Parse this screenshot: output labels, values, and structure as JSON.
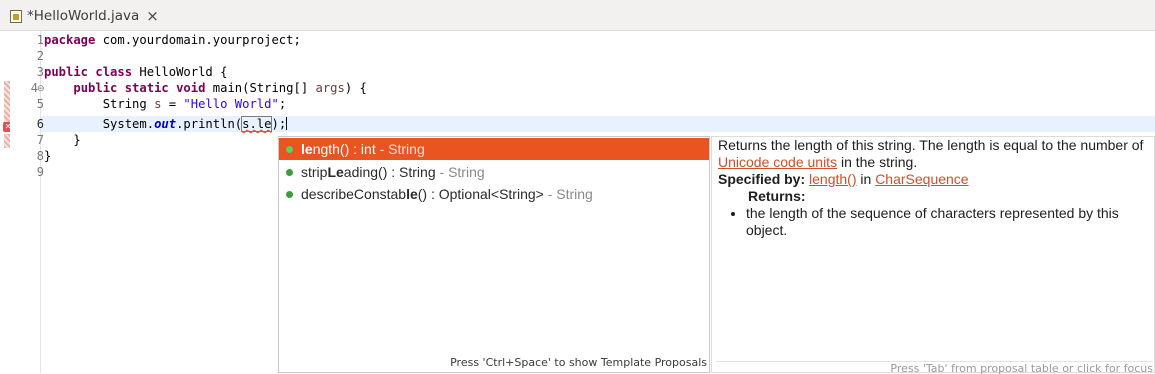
{
  "tab": {
    "title": "*HelloWorld.java",
    "close_glyph": "×",
    "icon": "java-file-icon"
  },
  "editor": {
    "line_numbers": [
      "1",
      "2",
      "3",
      "4",
      "5",
      "6",
      "7",
      "8",
      "9"
    ],
    "lines": {
      "l1_kw": "package",
      "l1_rest": " com.yourdomain.yourproject;",
      "l3_kw": "public class",
      "l3_rest": " HelloWorld {",
      "l4_indent": "    ",
      "l4_kw": "public static void",
      "l4_rest": " main(String[] ",
      "l4_param": "args",
      "l4_end": ") {",
      "l5_a": "        String ",
      "l5_var": "s",
      "l5_b": " = ",
      "l5_str": "\"Hello World\"",
      "l5_c": ";",
      "l6_a": "        System.",
      "l6_field": "out",
      "l6_b": ".println(",
      "l6_box": "s.le",
      "l6_c": ");",
      "l7": "    }",
      "l8": "}"
    }
  },
  "completion": {
    "proposals": [
      {
        "bold": "le",
        "rest": "ngth() : int",
        "type": " - String"
      },
      {
        "pre": "strip",
        "bold": "Le",
        "rest": "ading() : String",
        "type": " - String"
      },
      {
        "pre": "describeConstab",
        "bold": "le",
        "rest": "() : Optional<String>",
        "type": " - String"
      }
    ],
    "status": "Press 'Ctrl+Space' to show Template Proposals"
  },
  "doc": {
    "p1a": "Returns the length of this string. The length is equal to the number of ",
    "link1": "Unicode code units",
    "p1b": " in the string.",
    "specified_label": "Specified by:",
    "link2": "length()",
    "in_text": " in ",
    "link3": "CharSequence",
    "returns_label": "Returns:",
    "returns_item": "the length of the sequence of characters represented by this object.",
    "status": "Press 'Tab' from proposal table or click for focus"
  },
  "colors": {
    "selection": "#e95420",
    "keyword": "#7f0055",
    "string": "#2a00ff",
    "link": "#cf4f2a"
  }
}
